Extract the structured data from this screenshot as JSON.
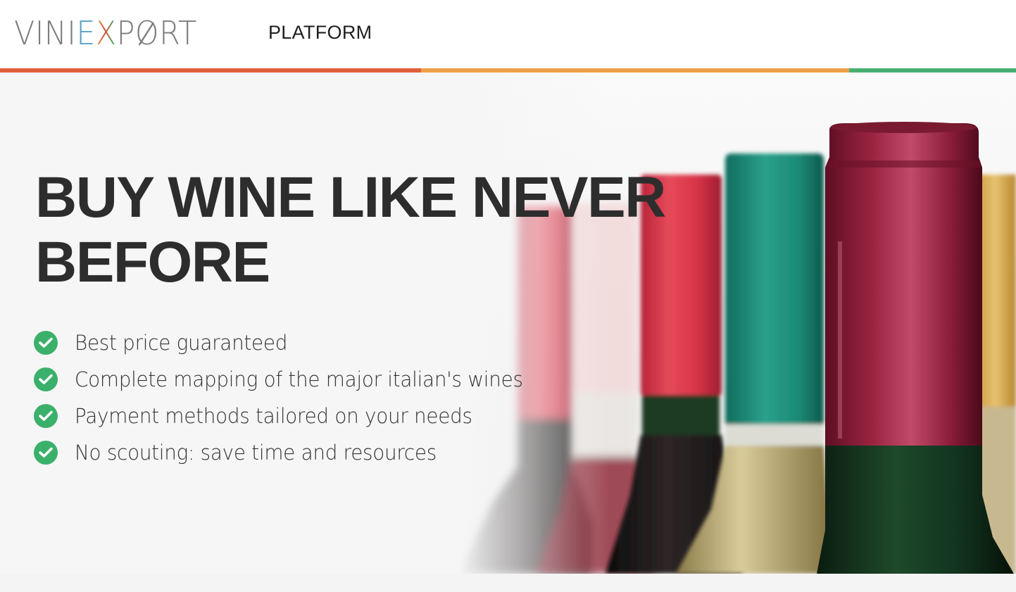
{
  "brand": {
    "logo_parts": [
      "VINI",
      "E",
      "X",
      "P",
      "O",
      "RT"
    ],
    "logo_text": "VINIEXPORT"
  },
  "nav": {
    "items": [
      {
        "label": "PLATFORM"
      }
    ]
  },
  "strip_colors": [
    "#e0603c",
    "#eea04a",
    "#4aae73"
  ],
  "hero": {
    "headline_line1": "BUY WINE LIKE NEVER",
    "headline_line2": "BEFORE",
    "features": [
      {
        "label": "Best price guaranteed",
        "icon": "check-circle-icon"
      },
      {
        "label": "Complete mapping of the major italian's wines",
        "icon": "check-circle-icon"
      },
      {
        "label": "Payment methods tailored on your needs",
        "icon": "check-circle-icon"
      },
      {
        "label": "No scouting: save time and resources",
        "icon": "check-circle-icon"
      }
    ],
    "image": "wine-bottles-photo"
  },
  "colors": {
    "accent_green": "#3bb06a",
    "headline": "#2d2d2d"
  }
}
